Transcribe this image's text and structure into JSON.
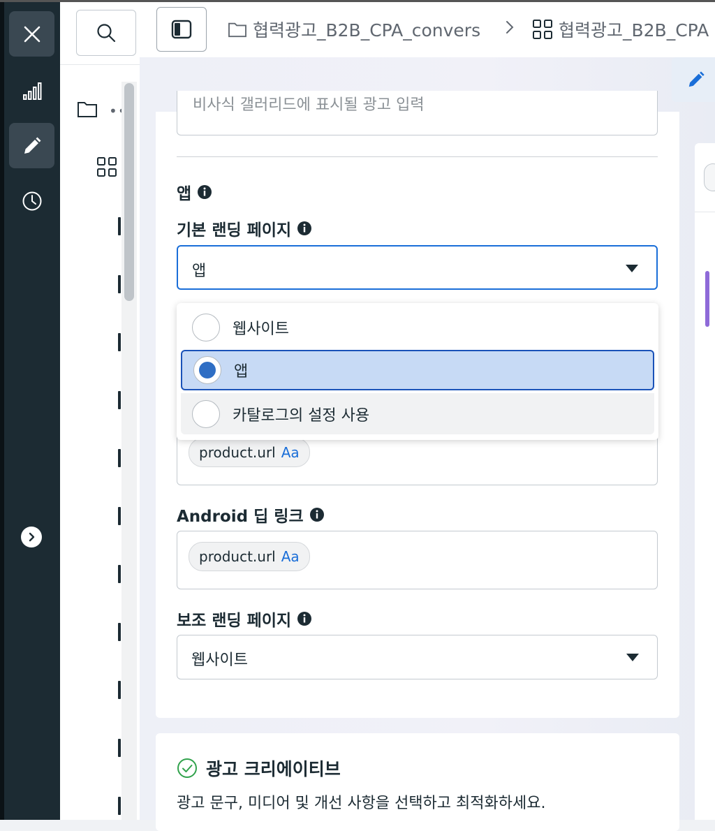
{
  "header": {
    "breadcrumb_campaign": "협력광고_B2B_CPA_convers",
    "breadcrumb_adset": "협력광고_B2B_CPA"
  },
  "form": {
    "top_input_placeholder": "비사식 갤러리드에 표시될 광고 입력",
    "app_section_label": "앱",
    "primary_landing_label": "기본 랜딩 페이지",
    "primary_landing_value": "앱",
    "primary_landing_options": [
      {
        "label": "웹사이트",
        "selected": false
      },
      {
        "label": "앱",
        "selected": true
      },
      {
        "label": "카탈로그의 설정 사용",
        "selected": false
      }
    ],
    "ios_link_chip": "product.url",
    "chip_suffix": "Aa",
    "android_label": "Android 딥 링크",
    "android_link_chip": "product.url",
    "secondary_landing_label": "보조 랜딩 페이지",
    "secondary_landing_value": "웹사이트"
  },
  "creative": {
    "title": "광고 크리에이티브",
    "subtitle": "광고 문구, 미디어 및 개선 사항을 선택하고 최적화하세요."
  },
  "colors": {
    "rail_bg": "#1c2b33",
    "accent": "#1a6ed8",
    "selected_option_bg": "#c7daf5",
    "success": "#31a24c"
  }
}
